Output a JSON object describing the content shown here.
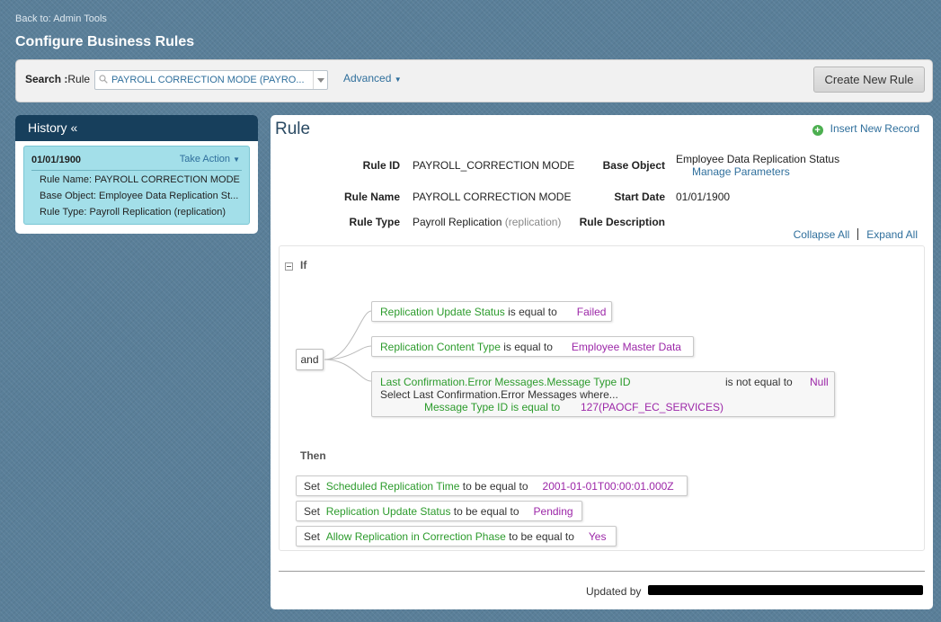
{
  "nav": {
    "back_link": "Back to: Admin Tools"
  },
  "page": {
    "title": "Configure Business Rules"
  },
  "search": {
    "label": "Search :",
    "type_label": "Rule",
    "value": "PAYROLL CORRECTION MODE (PAYRO...",
    "advanced_label": "Advanced",
    "create_button": "Create New Rule"
  },
  "history": {
    "title": "History «",
    "card": {
      "date": "01/01/1900",
      "action_label": "Take Action",
      "rule_name": "Rule Name: PAYROLL CORRECTION MODE",
      "base_object": "Base Object: Employee Data Replication St...",
      "rule_type": "Rule Type: Payroll Replication (replication)"
    }
  },
  "rule": {
    "heading": "Rule",
    "insert_link": "Insert New Record",
    "fields": {
      "rule_id_label": "Rule ID",
      "rule_id": "PAYROLL_CORRECTION MODE",
      "rule_name_label": "Rule Name",
      "rule_name": "PAYROLL CORRECTION MODE",
      "rule_type_label": "Rule Type",
      "rule_type": "Payroll Replication",
      "rule_type_suffix": "(replication)",
      "base_object_label": "Base Object",
      "base_object": "Employee Data Replication Status",
      "manage_parameters": "Manage Parameters",
      "start_date_label": "Start Date",
      "start_date": "01/01/1900",
      "description_label": "Rule Description"
    },
    "collapse_all": "Collapse All",
    "expand_all": "Expand All",
    "if_label": "If",
    "operator": "and",
    "conditions": [
      {
        "field": "Replication Update Status",
        "op": "is equal to",
        "value": "Failed"
      },
      {
        "field": "Replication Content Type",
        "op": "is equal to",
        "value": "Employee Master Data"
      }
    ],
    "condition3": {
      "field": "Last Confirmation.Error Messages.Message Type ID",
      "op": "is not equal to",
      "value": "Null",
      "select_text": "Select Last Confirmation.Error Messages where...",
      "sub_field": "Message Type ID is equal to",
      "sub_value": "127(PAOCF_EC_SERVICES)"
    },
    "then_label": "Then",
    "actions": [
      {
        "set": "Set",
        "field": "Scheduled Replication Time",
        "op": "to be equal to",
        "value": "2001-01-01T00:00:01.000Z"
      },
      {
        "set": "Set",
        "field": "Replication Update Status",
        "op": "to be equal to",
        "value": "Pending"
      },
      {
        "set": "Set",
        "field": "Allow Replication in Correction Phase",
        "op": "to be equal to",
        "value": "Yes"
      }
    ],
    "updated_by": "Updated by"
  }
}
